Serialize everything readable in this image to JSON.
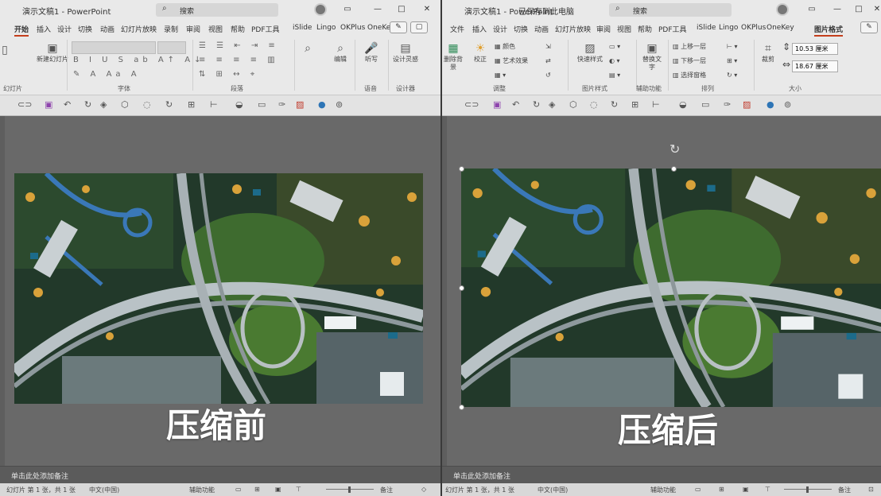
{
  "left": {
    "doc_title": "演示文稿1 - PowerPoint",
    "search_label": "搜索",
    "tabs": [
      "开始",
      "插入",
      "设计",
      "切换",
      "动画",
      "幻灯片放映",
      "录制",
      "审阅",
      "视图",
      "帮助",
      "PDF工具",
      "iSlide",
      "Lingo",
      "OKPlus",
      "OneKey"
    ],
    "active_tab": "开始",
    "groups": [
      "幻灯片",
      "字体",
      "段落",
      "",
      "语音",
      "设计器"
    ],
    "buttons": {
      "new_slide": "新建幻灯片",
      "editing": "编辑",
      "dictate": "听写",
      "designer": "设计灵感"
    },
    "notes": "单击此处添加备注",
    "status_slide": "幻灯片 第 1 张，共 1 张",
    "status_lang": "中文(中国)",
    "status_access": "辅助功能",
    "status_notes": "备注",
    "caption": "压缩前"
  },
  "right": {
    "doc_title": "演示文稿1 - PowerPoint",
    "context": "已保存到此电脑",
    "search_label": "搜索",
    "tabs": [
      "文件",
      "插入",
      "设计",
      "切换",
      "动画",
      "幻灯片放映",
      "审阅",
      "视图",
      "帮助",
      "PDF工具",
      "iSlide",
      "Lingo",
      "OKPlus",
      "OneKey",
      "图片格式"
    ],
    "active_tab": "图片格式",
    "groups": [
      "调整",
      "图片样式",
      "辅助功能",
      "排列",
      "大小"
    ],
    "buttons": {
      "remove_bg": "删除背景",
      "corrections": "校正",
      "color": "颜色",
      "artistic": "艺术效果",
      "compress": "压缩图片",
      "quick_styles": "快速样式",
      "alt_text": "替换文字",
      "bring_forward": "上移一层",
      "send_backward": "下移一层",
      "selection_pane": "选择窗格",
      "crop": "裁剪"
    },
    "height_value": "10.53 厘米",
    "width_value": "18.67 厘米",
    "notes": "单击此处添加备注",
    "status_slide": "幻灯片 第 1 张，共 1 张",
    "status_lang": "中文(中国)",
    "status_access": "辅助功能",
    "status_notes": "备注",
    "caption": "压缩后"
  },
  "colors": {
    "ribbon_bg": "#e9e9e9",
    "canvas_bg": "#696969",
    "accent": "#c43e1c",
    "caption": "#ffffff"
  }
}
